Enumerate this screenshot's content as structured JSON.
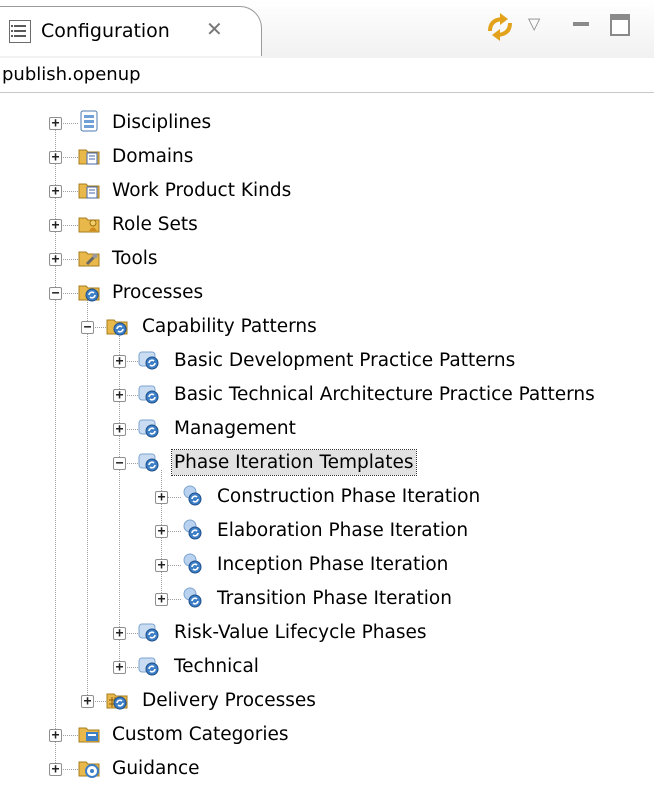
{
  "tab": {
    "title": "Configuration",
    "close_glyph": "✕",
    "icon": "configuration-view-icon"
  },
  "toolbar": {
    "sync_icon": "synchronize-icon",
    "menu_glyph": "▽",
    "minimize_icon": "minimize-icon",
    "maximize_icon": "maximize-icon"
  },
  "configuration_name": "publish.openup",
  "tree": {
    "nodes": [
      {
        "label": "Disciplines",
        "depth": 0,
        "expander": "+",
        "icon": "disciplines-icon"
      },
      {
        "label": "Domains",
        "depth": 0,
        "expander": "+",
        "icon": "domains-icon"
      },
      {
        "label": "Work Product Kinds",
        "depth": 0,
        "expander": "+",
        "icon": "work-product-kinds-icon"
      },
      {
        "label": "Role Sets",
        "depth": 0,
        "expander": "+",
        "icon": "role-sets-icon"
      },
      {
        "label": "Tools",
        "depth": 0,
        "expander": "+",
        "icon": "tools-icon"
      },
      {
        "label": "Processes",
        "depth": 0,
        "expander": "−",
        "icon": "processes-icon"
      },
      {
        "label": "Capability Patterns",
        "depth": 1,
        "expander": "−",
        "icon": "capability-patterns-folder-icon"
      },
      {
        "label": "Basic Development Practice Patterns",
        "depth": 2,
        "expander": "+",
        "icon": "capability-pattern-icon"
      },
      {
        "label": "Basic Technical Architecture Practice Patterns",
        "depth": 2,
        "expander": "+",
        "icon": "capability-pattern-icon"
      },
      {
        "label": "Management",
        "depth": 2,
        "expander": "+",
        "icon": "capability-pattern-icon"
      },
      {
        "label": "Phase Iteration Templates",
        "depth": 2,
        "expander": "−",
        "icon": "capability-pattern-icon",
        "selected": true
      },
      {
        "label": "Construction Phase Iteration",
        "depth": 3,
        "expander": "+",
        "icon": "capability-pattern-item-icon"
      },
      {
        "label": "Elaboration Phase Iteration",
        "depth": 3,
        "expander": "+",
        "icon": "capability-pattern-item-icon"
      },
      {
        "label": "Inception Phase Iteration",
        "depth": 3,
        "expander": "+",
        "icon": "capability-pattern-item-icon"
      },
      {
        "label": "Transition Phase Iteration",
        "depth": 3,
        "expander": "+",
        "icon": "capability-pattern-item-icon"
      },
      {
        "label": "Risk-Value Lifecycle Phases",
        "depth": 2,
        "expander": "+",
        "icon": "capability-pattern-icon"
      },
      {
        "label": "Technical",
        "depth": 2,
        "expander": "+",
        "icon": "capability-pattern-icon"
      },
      {
        "label": "Delivery Processes",
        "depth": 1,
        "expander": "+",
        "icon": "delivery-processes-folder-icon"
      },
      {
        "label": "Custom Categories",
        "depth": 0,
        "expander": "+",
        "icon": "custom-categories-icon"
      },
      {
        "label": "Guidance",
        "depth": 0,
        "expander": "+",
        "icon": "guidance-icon"
      }
    ]
  },
  "colors": {
    "folder": "#e8b84a",
    "process_blue": "#2f6fb5",
    "selection": "#e2e2e2"
  }
}
